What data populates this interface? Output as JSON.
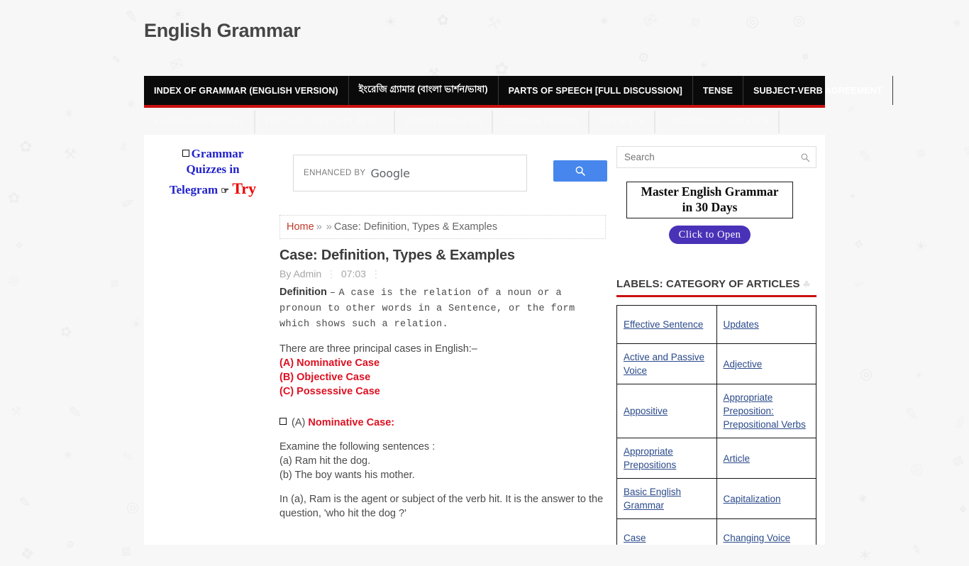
{
  "header": {
    "site_title": "English Grammar"
  },
  "nav": {
    "items": [
      {
        "label": "INDEX OF GRAMMAR (ENGLISH VERSION)",
        "name": "nav-index-of-grammar"
      },
      {
        "label": "ইংরেজি গ্র্যামার (বাংলা ভার্শন/ভাষা)",
        "name": "nav-bangla-version"
      },
      {
        "label": "PARTS OF SPEECH [FULL DISCUSSION]",
        "name": "nav-parts-of-speech"
      },
      {
        "label": "TENSE",
        "name": "nav-tense"
      },
      {
        "label": "SUBJECT-VERB AGREEMENT",
        "name": "nav-subject-verb-agreement"
      }
    ]
  },
  "nav_secondary": {
    "items": [
      {
        "label": "IDIOMS AND PHRASES",
        "name": "nav2-idioms-and-phrases"
      },
      {
        "label": "PARTS OF SPEECH IN DETAIL",
        "name": "nav2-parts-of-speech-in-detail"
      },
      {
        "label": "WORD FORMATION",
        "name": "nav2-word-formation"
      },
      {
        "label": "COMMON ERRORS",
        "name": "nav2-common-errors"
      },
      {
        "label": "SENTENCE",
        "name": "nav2-sentence"
      },
      {
        "label": "CONDITIONAL SENTENCE",
        "name": "nav2-conditional-sentence"
      }
    ]
  },
  "left_rail": {
    "promo_line1": "Grammar",
    "promo_line2": "Quizzes in",
    "promo_line3": "Telegram",
    "promo_try": "Try"
  },
  "cse": {
    "placeholder_prefix": "ENHANCED BY",
    "brand": "Google",
    "search_icon": "search-icon"
  },
  "breadcrumb": {
    "home": "Home",
    "sep1": "»",
    "sep2": "»",
    "current": "Case: Definition, Types & Examples"
  },
  "post": {
    "title": "Case: Definition, Types & Examples",
    "author": "By Admin",
    "time": "07:03",
    "definition_label": "Definition",
    "definition_dash": "–",
    "definition_text": "A case is the relation of a noun or a pronoun to other words in a Sentence, or the form which shows such a relation.",
    "intro": "There are three principal cases in English:–",
    "cases": [
      "(A) Nominative Case",
      "(B) Objective Case",
      "(C) Possessive Case"
    ],
    "section_prefix": "(A)",
    "section_title": "Nominative Case:",
    "examine_line": "Examine the following sentences :",
    "example_a": "(a) Ram hit the dog.",
    "example_b": "(b) The boy wants his mother.",
    "explanation": "In (a), Ram is the agent or subject of the verb hit. It is the answer to the question, 'who hit the dog ?'"
  },
  "sidebar": {
    "search_placeholder": "Search",
    "search_icon": "search-icon",
    "banner_line1": "Master English Grammar",
    "banner_line2": "in 30 Days",
    "banner_cta": "Click to Open",
    "labels_heading": "LABELS: CATEGORY OF ARTICLES",
    "labels_rows": [
      [
        "Effective Sentence ",
        "Updates "
      ],
      [
        "Active and Passive Voice",
        "Adjective"
      ],
      [
        "Appositive",
        "Appropriate Preposition: Prepositional Verbs"
      ],
      [
        "Appropriate Prepositions",
        "Article"
      ],
      [
        "Basic English Grammar",
        "Capitalization"
      ],
      [
        "Case",
        "Changing Voice"
      ]
    ]
  },
  "colors": {
    "accent_red": "#cc1111",
    "nav_black": "#0a0a0a",
    "link_blue": "#2b4a8b",
    "cta_purple": "#4a32b8",
    "google_blue": "#4787ed",
    "case_red": "#dd1122"
  }
}
